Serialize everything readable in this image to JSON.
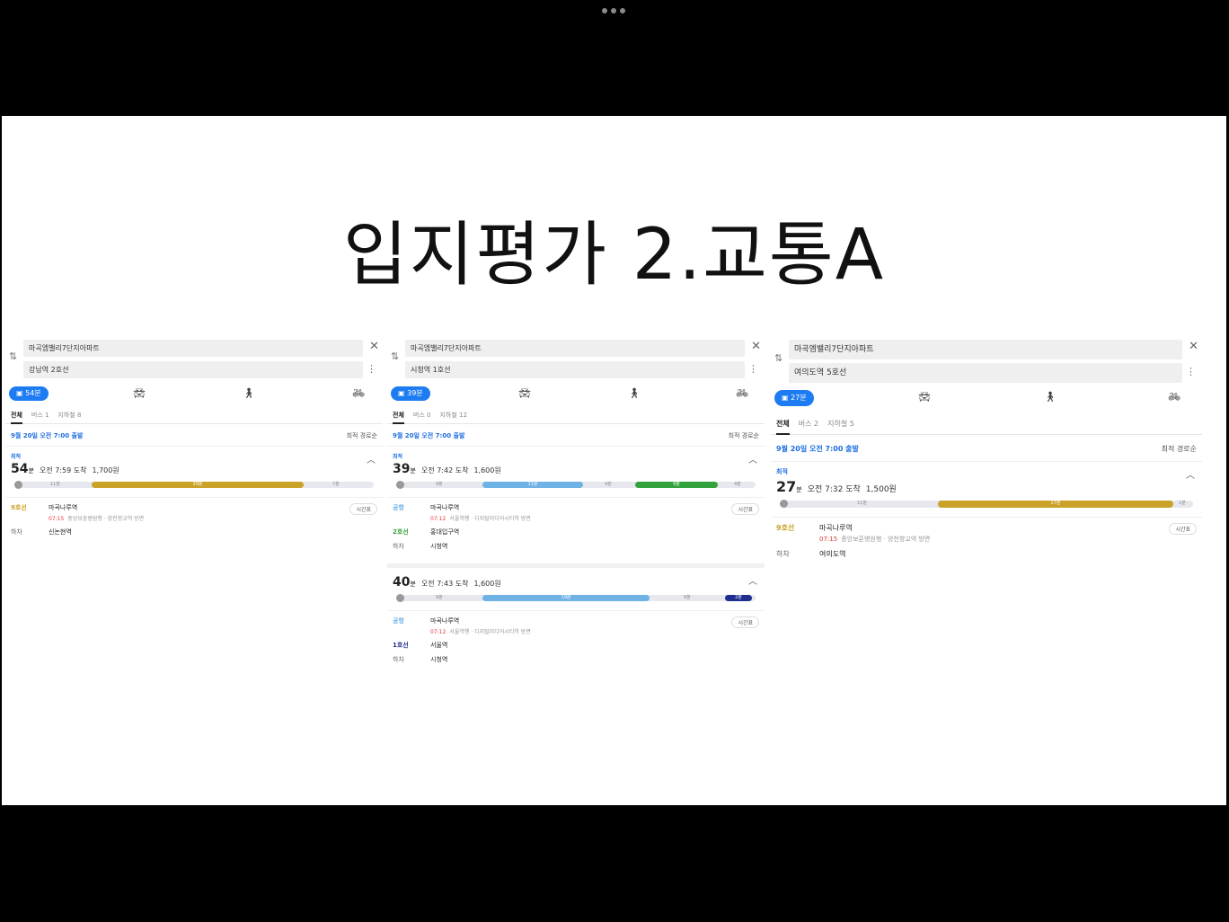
{
  "slide": {
    "title": "입지평가 2.교통A"
  },
  "panels": [
    {
      "origin": "마곡엠밸리7단지아파트",
      "destination": "강남역 2호선",
      "transit_label": "54분",
      "tabs": [
        "전체",
        "버스 1",
        "지하철 8"
      ],
      "depart": "9월 20일 오전 7:00 출발",
      "sort": "최적 경로순",
      "routes": [
        {
          "best": "최적",
          "mins": "54",
          "mins_unit": "분",
          "arrive": "오전 7:59 도착",
          "fare": "1,700원",
          "bar": [
            "11분",
            "39분",
            "7분"
          ],
          "steps": [
            {
              "line": "9호선",
              "station": "마곡나루역",
              "time": "07:15",
              "sub": "중앙보훈병원행 · 양천향교역 방면",
              "btn": "시간표"
            },
            {
              "line": "하차",
              "station": "신논현역"
            }
          ]
        }
      ]
    },
    {
      "origin": "마곡엠밸리7단지아파트",
      "destination": "시청역 1호선",
      "transit_label": "39분",
      "tabs": [
        "전체",
        "버스 0",
        "지하철 12"
      ],
      "depart": "9월 20일 오전 7:00 출발",
      "sort": "최적 경로순",
      "routes": [
        {
          "best": "최적",
          "mins": "39",
          "mins_unit": "분",
          "arrive": "오전 7:42 도착",
          "fare": "1,600원",
          "bar": [
            "9분",
            "11분",
            "4분",
            "9분",
            "4분"
          ],
          "steps": [
            {
              "line": "공항",
              "station": "마곡나루역",
              "time": "07:12",
              "sub": "서울역행 · 디지털미디어시티역 방면",
              "btn": "시간표"
            },
            {
              "line": "2호선",
              "station": "홍대입구역"
            },
            {
              "line": "하차",
              "station": "시청역"
            }
          ]
        },
        {
          "best": "",
          "mins": "40",
          "mins_unit": "분",
          "arrive": "오전 7:43 도착",
          "fare": "1,600원",
          "bar": [
            "9분",
            "19분",
            "9분",
            "2분"
          ],
          "steps": [
            {
              "line": "공항",
              "station": "마곡나루역",
              "time": "07:12",
              "sub": "서울역행 · 디지털미디어시티역 방면",
              "btn": "시간표"
            },
            {
              "line": "1호선",
              "station": "서울역"
            },
            {
              "line": "하차",
              "station": "시청역"
            }
          ]
        }
      ]
    },
    {
      "origin": "마곡엠밸리7단지아파트",
      "destination": "여의도역 5호선",
      "transit_label": "27분",
      "tabs": [
        "전체",
        "버스 2",
        "지하철 5"
      ],
      "depart": "9월 20일 오전 7:00 출발",
      "sort": "최적 경로순",
      "routes": [
        {
          "best": "최적",
          "mins": "27",
          "mins_unit": "분",
          "arrive": "오전 7:32 도착",
          "fare": "1,500원",
          "bar": [
            "11분",
            "17분",
            "1분"
          ],
          "steps": [
            {
              "line": "9호선",
              "station": "마곡나루역",
              "time": "07:15",
              "sub": "중앙보훈병원행 · 양천향교역 방면",
              "btn": "시간표"
            },
            {
              "line": "하차",
              "station": "여의도역"
            }
          ]
        }
      ]
    }
  ],
  "icons": {
    "bus": "bus-icon",
    "car": "car-icon",
    "walk": "walk-icon",
    "bike": "bike-icon",
    "swap": "swap-icon",
    "close": "close-icon",
    "more": "more-icon"
  },
  "colors": {
    "line9": "#c9a227",
    "airport": "#6fb2e6",
    "line2": "#33a23d",
    "line1": "#1f2f8f",
    "accent": "#1e7cf2"
  }
}
